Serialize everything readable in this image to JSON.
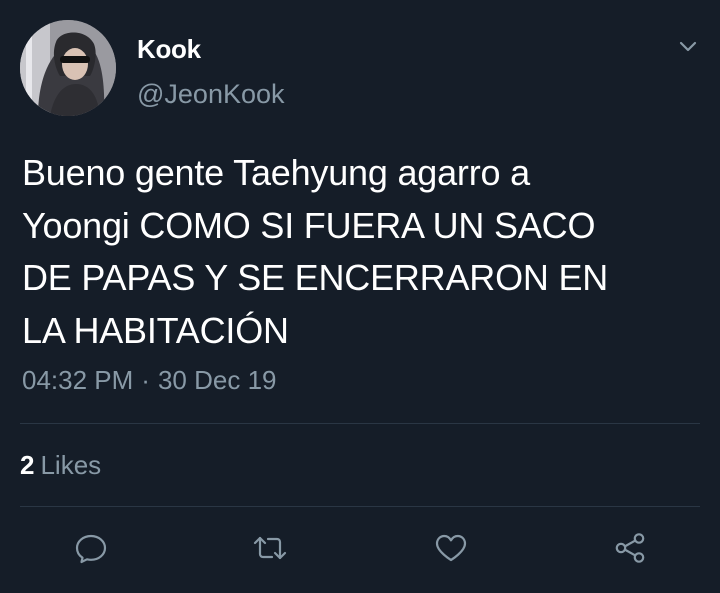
{
  "user": {
    "display_name": "Kook",
    "handle": "@JeonKook",
    "avatar_icon": "profile-photo"
  },
  "tweet": {
    "text_lines": [
      "Bueno gente Taehyung agarro a",
      "Yoongi COMO SI FUERA UN SACO",
      "DE PAPAS Y SE ENCERRARON EN",
      "LA HABITACIÓN"
    ],
    "time": "04:32 PM",
    "separator": "·",
    "date": "30 Dec 19"
  },
  "stats": {
    "likes_count": "2",
    "likes_label": "Likes"
  },
  "actions": [
    "reply-icon",
    "retweet-icon",
    "like-icon",
    "share-icon"
  ],
  "colors": {
    "background": "#151d28",
    "text": "#ffffff",
    "secondary": "#8899a6",
    "divider": "#2a3644"
  }
}
